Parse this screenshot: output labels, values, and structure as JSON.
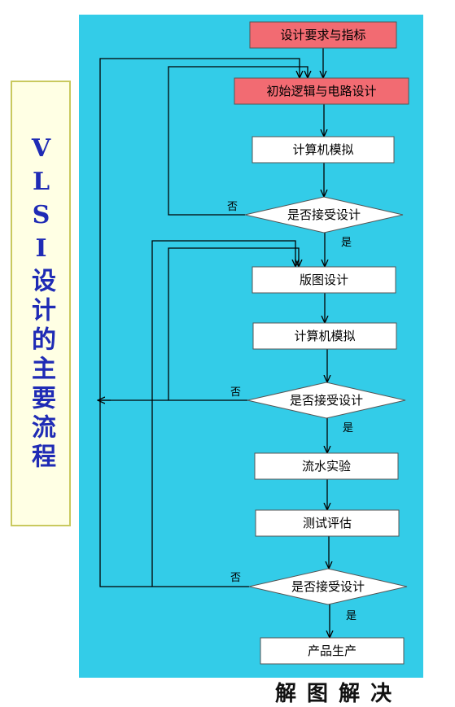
{
  "title": "VLSI设计的主要流程",
  "colors": {
    "panel": "#33cce8",
    "highlight_fill": "#f26b72",
    "node_fill": "#ffffff",
    "line": "#000000",
    "title_text": "#1f2bb5"
  },
  "nodes": [
    {
      "id": "requirements",
      "label": "设计要求与指标",
      "shape": "rect",
      "highlight": true
    },
    {
      "id": "logic-circuit-design",
      "label": "初始逻辑与电路设计",
      "shape": "rect",
      "highlight": true
    },
    {
      "id": "simulation-1",
      "label": "计算机模拟",
      "shape": "rect",
      "highlight": false
    },
    {
      "id": "decision-1",
      "label": "是否接受设计",
      "shape": "diamond",
      "highlight": false
    },
    {
      "id": "layout-design",
      "label": "版图设计",
      "shape": "rect",
      "highlight": false
    },
    {
      "id": "simulation-2",
      "label": "计算机模拟",
      "shape": "rect",
      "highlight": false
    },
    {
      "id": "decision-2",
      "label": "是否接受设计",
      "shape": "diamond",
      "highlight": false
    },
    {
      "id": "fabrication-test",
      "label": "流水实验",
      "shape": "rect",
      "highlight": false
    },
    {
      "id": "test-evaluation",
      "label": "测试评估",
      "shape": "rect",
      "highlight": false
    },
    {
      "id": "decision-3",
      "label": "是否接受设计",
      "shape": "diamond",
      "highlight": false
    },
    {
      "id": "production",
      "label": "产品生产",
      "shape": "rect",
      "highlight": false
    }
  ],
  "edges": [
    {
      "from": "requirements",
      "to": "logic-circuit-design",
      "label": ""
    },
    {
      "from": "logic-circuit-design",
      "to": "simulation-1",
      "label": ""
    },
    {
      "from": "simulation-1",
      "to": "decision-1",
      "label": ""
    },
    {
      "from": "decision-1",
      "to": "layout-design",
      "label": "是"
    },
    {
      "from": "decision-1",
      "to": "logic-circuit-design",
      "label": "否"
    },
    {
      "from": "layout-design",
      "to": "simulation-2",
      "label": ""
    },
    {
      "from": "simulation-2",
      "to": "decision-2",
      "label": ""
    },
    {
      "from": "decision-2",
      "to": "fabrication-test",
      "label": "是"
    },
    {
      "from": "decision-2",
      "to": "layout-design",
      "label": "否"
    },
    {
      "from": "decision-2",
      "to": "logic-circuit-design",
      "label": "否"
    },
    {
      "from": "fabrication-test",
      "to": "test-evaluation",
      "label": ""
    },
    {
      "from": "test-evaluation",
      "to": "decision-3",
      "label": ""
    },
    {
      "from": "decision-3",
      "to": "production",
      "label": "是"
    },
    {
      "from": "decision-3",
      "to": "layout-design",
      "label": "否"
    },
    {
      "from": "decision-3",
      "to": "logic-circuit-design",
      "label": "否"
    }
  ],
  "footer_fragment": "解 图 解 决"
}
